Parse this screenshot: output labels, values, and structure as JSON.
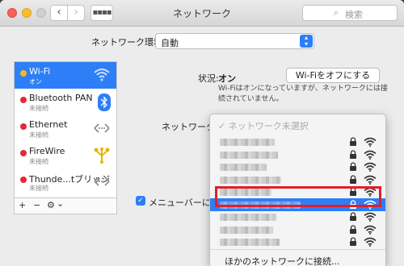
{
  "window": {
    "title": "ネットワーク"
  },
  "search": {
    "placeholder": "検索"
  },
  "location": {
    "label": "ネットワーク環境:",
    "value": "自動"
  },
  "services": [
    {
      "name": "Wi-Fi",
      "status": "オン",
      "color": "#f0b72f",
      "icon": "wifi-icon",
      "selected": true
    },
    {
      "name": "Bluetooth PAN",
      "status": "未接続",
      "color": "#e3283a",
      "icon": "bluetooth-icon"
    },
    {
      "name": "Ethernet",
      "status": "未接続",
      "color": "#e3283a",
      "icon": "ethernet-icon"
    },
    {
      "name": "FireWire",
      "status": "未接続",
      "color": "#e3283a",
      "icon": "firewire-icon"
    },
    {
      "name": "Thunde...tブリッジ",
      "status": "未接続",
      "color": "#e3283a",
      "icon": "ethernet-icon"
    }
  ],
  "list_controls": {
    "add": "+",
    "remove": "−",
    "gear": "⚙",
    "chevron": "⌄"
  },
  "detail": {
    "status_label": "状況:",
    "status_value": "オン",
    "wifi_off_button": "Wi-Fiをオフにする",
    "status_description": "Wi-Fiはオンになっていますが、ネットワークには接続されていません。",
    "network_name_label": "ネットワーク名",
    "menubar_label": "メニューバーにWi"
  },
  "dropdown": {
    "current": "✓ ネットワーク未選択",
    "other_networks": "ほかのネットワークに接続...",
    "highlighted_index": 5,
    "network_count": 9
  },
  "colors": {
    "accent": "#2e7ef7",
    "highlight_box": "#e02027"
  }
}
